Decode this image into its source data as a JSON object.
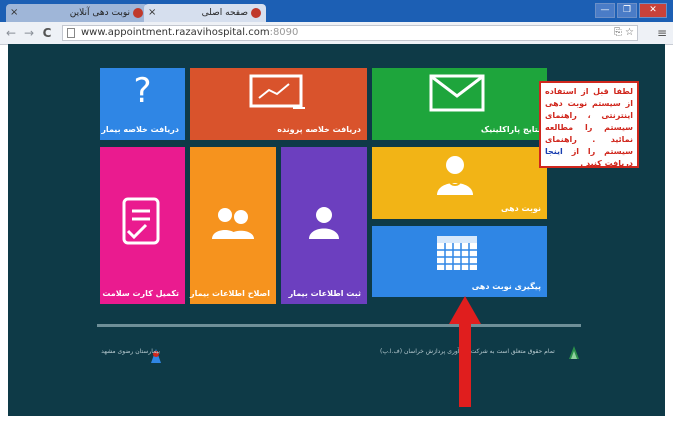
{
  "browser": {
    "tabs": [
      {
        "title": "نوبت دهی آنلاین",
        "close": "×"
      },
      {
        "title": "صفحه اصلی",
        "close": "×"
      }
    ],
    "window_buttons": [
      "—",
      "❐",
      "✕"
    ],
    "nav": {
      "back": "←",
      "forward": "→",
      "reload": "C",
      "menu": "≡"
    },
    "url": {
      "host": "www.appointment.razavihospital.com",
      "port": ":8090"
    },
    "omnibox_icons": "⎘ ☆"
  },
  "tiles": {
    "file_summary": "دریافت خلاصه پرونده",
    "patient_summary": "دریافت خلاصه بیمار",
    "question_mark": "?",
    "paraclinic": "نتایج پاراکلینیک",
    "appointment": "نوبت دهی",
    "tracking": "پیگیری نوبت دهی",
    "register_patient": "ثبت اطلاعات بیمار",
    "edit_patient": "اصلاح اطلاعات بیمار",
    "health_card": "تکمیل کارت سلامت"
  },
  "notice": {
    "text": "لطفا قبل از استفاده از سیستم نوبت دهی اینترنتی ، راهنمای سیستم را مطالعه نمائید . راهنمای سیستم را از",
    "link": "اینجا",
    "after": "دریافت کنید ."
  },
  "footer": {
    "left": "بیمارستان رضوی مشهد",
    "right": "تمام حقوق متعلق است به شرکت فن آوری پردازش خراسان (ف.ا.پ)"
  },
  "colors": {
    "page_bg": "#0e3a47",
    "blue": "#2f86e5",
    "red": "#d9532c",
    "green": "#1ea53c",
    "yellow": "#f2b416",
    "pink": "#ea1b8f",
    "orange": "#f6931e",
    "purple": "#6c3fbf",
    "arrow": "#e01e1e"
  }
}
